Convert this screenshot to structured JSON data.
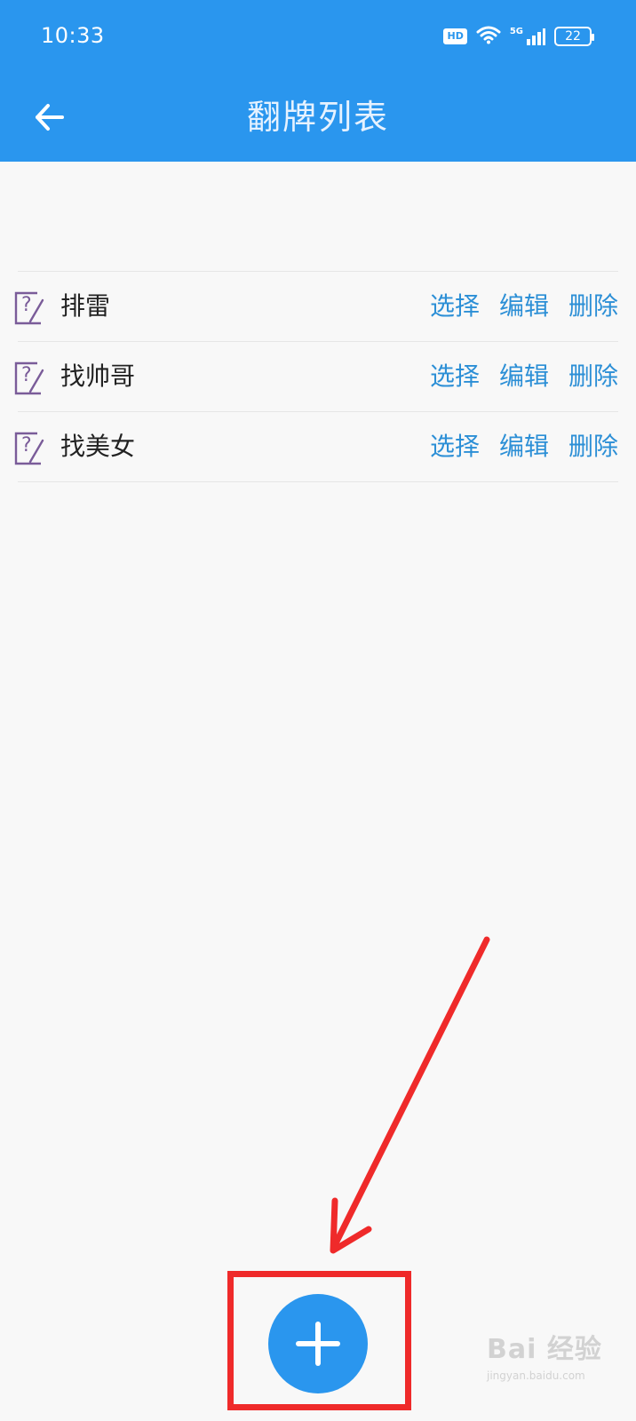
{
  "status_bar": {
    "time": "10:33",
    "hd_label": "HD",
    "network_label": "5G",
    "battery": "22",
    "icons": [
      "hd-icon",
      "wifi-icon",
      "signal-icon",
      "battery-icon"
    ]
  },
  "app_bar": {
    "title": "翻牌列表",
    "back_icon": "arrow-left-icon"
  },
  "list": {
    "items": [
      {
        "label": "排雷",
        "select": "选择",
        "edit": "编辑",
        "delete": "删除"
      },
      {
        "label": "找帅哥",
        "select": "选择",
        "edit": "编辑",
        "delete": "删除"
      },
      {
        "label": "找美女",
        "select": "选择",
        "edit": "编辑",
        "delete": "删除"
      }
    ],
    "item_icon": "question-note-icon"
  },
  "fab": {
    "icon": "plus-icon"
  },
  "annotation": {
    "color": "#ef2a2a",
    "type": "arrow-and-box"
  },
  "watermark": {
    "top": "Bai 经验",
    "bottom": "jingyan.baidu.com"
  },
  "colors": {
    "primary": "#2a96ee",
    "link": "#2c8fd6",
    "icon": "#7a5c99",
    "annotation": "#ef2a2a"
  }
}
